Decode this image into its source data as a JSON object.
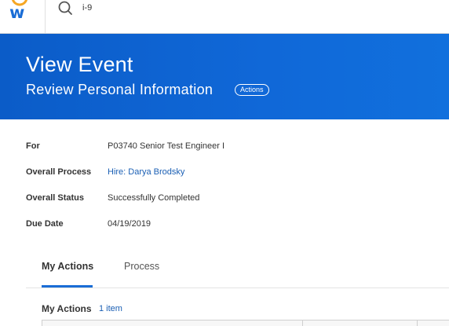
{
  "header": {
    "logo_letter": "w",
    "search": {
      "value": "i-9"
    }
  },
  "page": {
    "title": "View Event",
    "subtitle": "Review Personal Information",
    "actions_label": "Actions"
  },
  "details": [
    {
      "label": "For",
      "value": "P03740 Senior Test Engineer I",
      "is_link": false
    },
    {
      "label": "Overall Process",
      "value": "Hire: Darya Brodsky",
      "is_link": true
    },
    {
      "label": "Overall Status",
      "value": "Successfully Completed",
      "is_link": false
    },
    {
      "label": "Due Date",
      "value": "04/19/2019",
      "is_link": false
    }
  ],
  "tabs": [
    {
      "label": "My Actions",
      "active": true
    },
    {
      "label": "Process",
      "active": false
    }
  ],
  "section": {
    "title": "My Actions",
    "count": "1 item"
  },
  "colors": {
    "brand_blue": "#0b5cc8",
    "link": "#1a5fb4",
    "logo_arc": "#f5a623"
  }
}
